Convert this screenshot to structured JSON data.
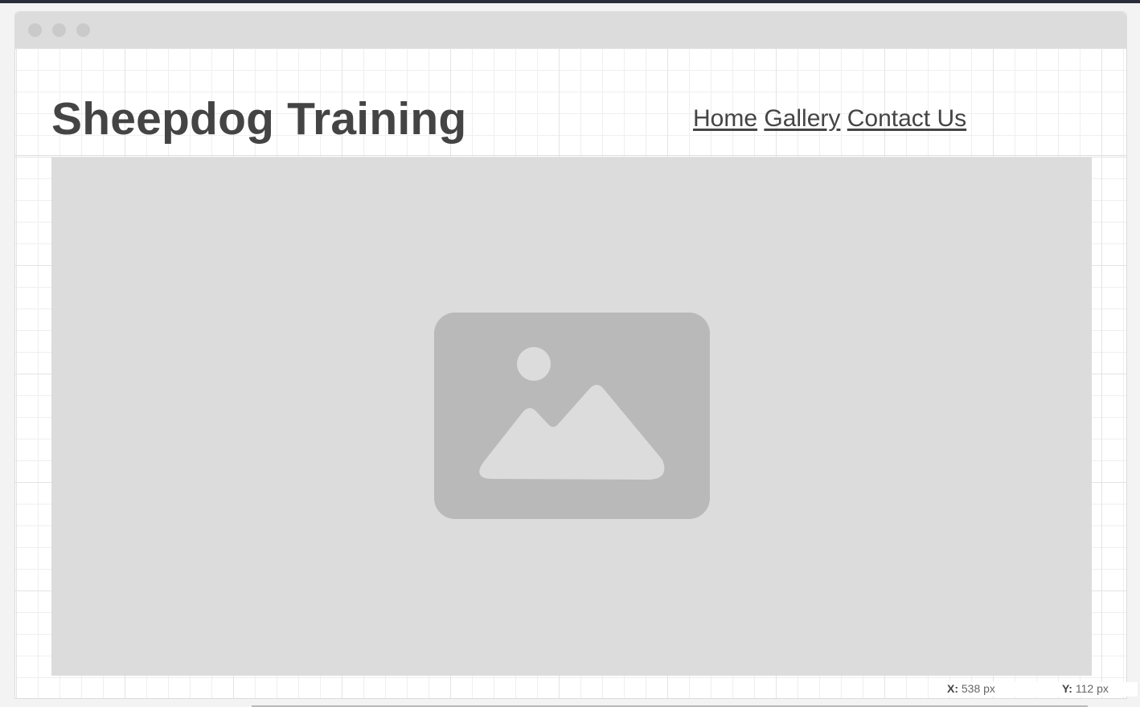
{
  "site": {
    "title": "Sheepdog Training"
  },
  "nav": {
    "items": [
      "Home",
      "Gallery",
      "Contact Us"
    ]
  },
  "hero": {
    "icon": "image-placeholder-icon"
  },
  "cursor": {
    "x_label": "X:",
    "x_value": "538 px",
    "y_label": "Y:",
    "y_value": "112 px"
  },
  "colors": {
    "text": "#444444",
    "placeholder_bg": "#dcdcdc",
    "placeholder_icon": "#b9b9b9",
    "topbar": "#2a2d3a"
  }
}
